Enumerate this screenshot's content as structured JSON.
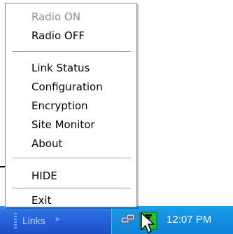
{
  "menu": {
    "items": [
      {
        "label": "Radio ON",
        "enabled": false
      },
      {
        "label": "Radio OFF",
        "enabled": true
      },
      {
        "label": "Link Status",
        "enabled": true
      },
      {
        "label": "Configuration",
        "enabled": true
      },
      {
        "label": "Encryption",
        "enabled": true
      },
      {
        "label": "Site Monitor",
        "enabled": true
      },
      {
        "label": "About",
        "enabled": true
      },
      {
        "label": "HIDE",
        "enabled": true
      },
      {
        "label": "Exit",
        "enabled": true
      }
    ]
  },
  "taskbar": {
    "links_label": "Links",
    "links_chevron": "»",
    "clock": "12:07 PM",
    "tray_icons": [
      "network-computers-icon",
      "wireless-antenna-icon"
    ],
    "colors": {
      "taskbar": "#245edb",
      "tray": "#0f83d8",
      "radio_icon_bg": "#22c22a"
    }
  }
}
